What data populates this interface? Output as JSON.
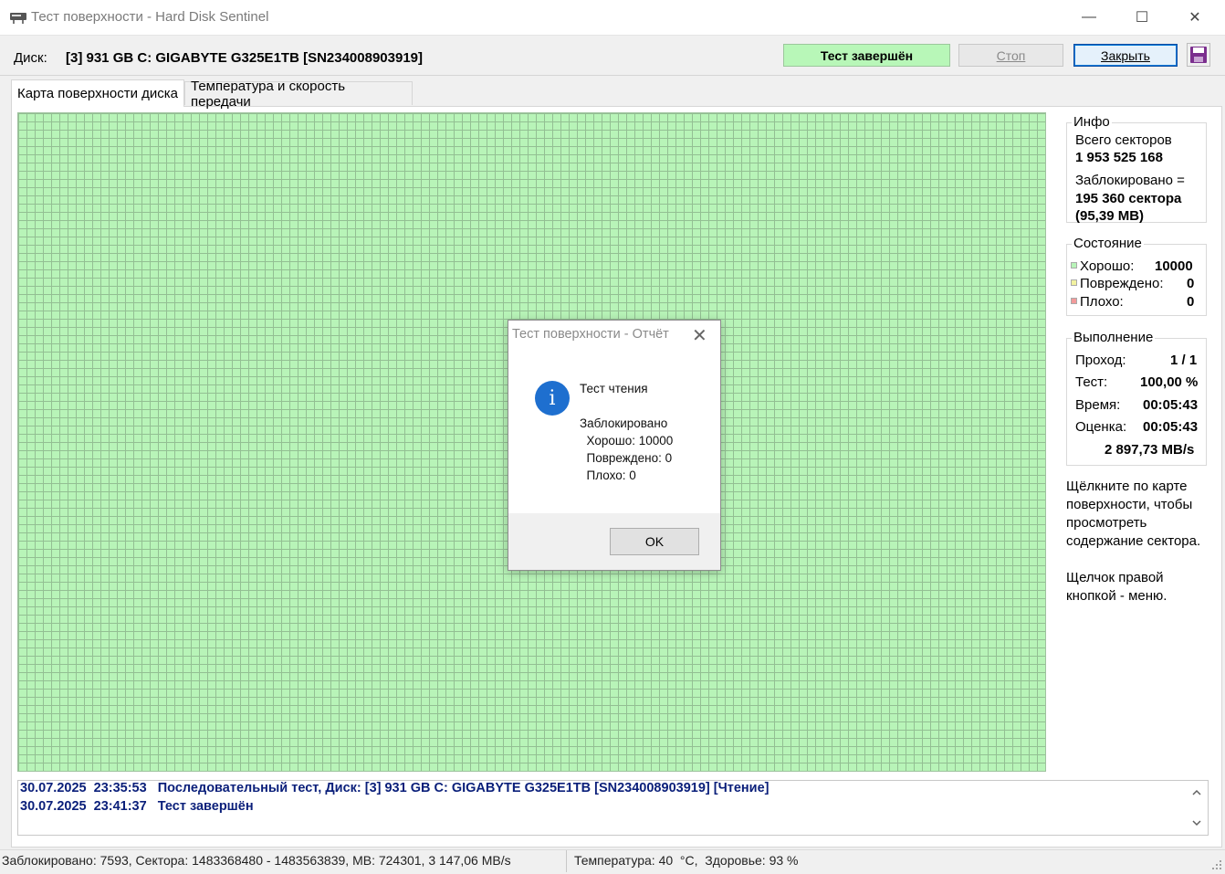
{
  "window": {
    "title": "Тест поверхности - Hard Disk Sentinel",
    "minimize": "—",
    "maximize": "☐",
    "close": "✕"
  },
  "header": {
    "disk_label": "Диск:",
    "disk_name": "[3] 931 GB C: GIGABYTE G325E1TB [SN234008903919]",
    "status_button": "Тест завершён",
    "stop_button": "Стоп",
    "close_button": "Закрыть"
  },
  "tabs": [
    {
      "label": "Карта поверхности диска",
      "active": true
    },
    {
      "label": "Температура и скорость передачи",
      "active": false
    }
  ],
  "info": {
    "title": "Инфо",
    "total_sectors_label": "Всего секторов",
    "total_sectors_value": "1 953 525 168",
    "blocked_label": "Заблокировано =",
    "blocked_value": "195 360 сектора",
    "blocked_mb": "(95,39 MB)"
  },
  "state": {
    "title": "Состояние",
    "good_label": "Хорошо:",
    "good_value": "10000",
    "damaged_label": "Повреждено:",
    "damaged_value": "0",
    "bad_label": "Плохо:",
    "bad_value": "0",
    "colors": {
      "good": "#b8f4b8",
      "damaged": "#f2f2a0",
      "bad": "#f29a9a"
    }
  },
  "progress": {
    "title": "Выполнение",
    "pass_label": "Проход:",
    "pass_value": "1 / 1",
    "test_label": "Тест:",
    "test_value": "100,00 %",
    "time_label": "Время:",
    "time_value": "00:05:43",
    "estimate_label": "Оценка:",
    "estimate_value": "00:05:43",
    "speed_value": "2 897,73 MB/s"
  },
  "hints": {
    "hint1_line1": "Щёлкните по карте",
    "hint1_line2": "поверхности, чтобы",
    "hint1_line3": "просмотреть",
    "hint1_line4": "содержание сектора.",
    "hint2_line1": "Щелчок правой",
    "hint2_line2": "кнопкой - меню."
  },
  "log": [
    "30.07.2025  23:35:53   Последовательный тест, Диск: [3] 931 GB C: GIGABYTE G325E1TB [SN234008903919] [Чтение]",
    "30.07.2025  23:41:37   Тест завершён"
  ],
  "statusbar": {
    "left": "Заблокировано: 7593, Сектора: 1483368480 - 1483563839, MB: 724301, 3 147,06 MB/s",
    "right": "Температура: 40  °C,  Здоровье: 93 %"
  },
  "dialog": {
    "title": "Тест поверхности - Отчёт",
    "close": "✕",
    "icon_glyph": "i",
    "line1": "Тест чтения",
    "line2": "Заблокировано",
    "line3": "  Хорошо: 10000",
    "line4": "  Повреждено: 0",
    "line5": "  Плохо: 0",
    "ok": "OK"
  }
}
